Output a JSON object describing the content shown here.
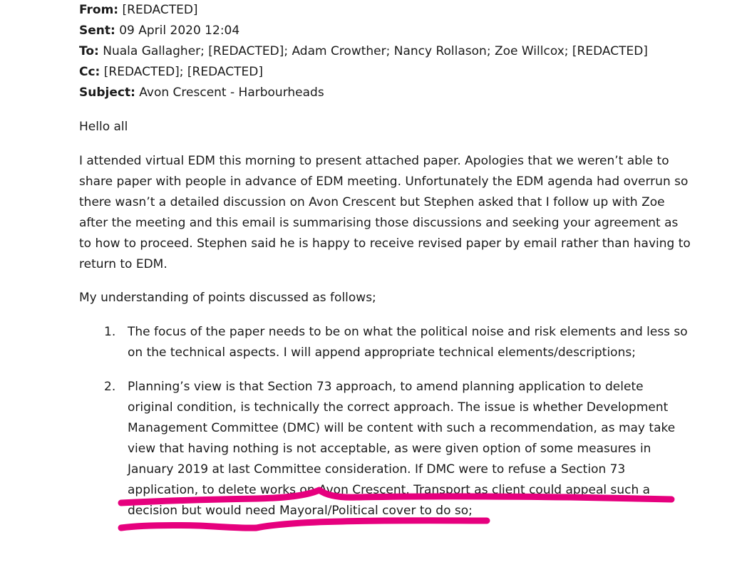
{
  "email_header": {
    "from_label": "From:",
    "from_value": "[REDACTED]",
    "sent_label": "Sent:",
    "sent_value": "09 April 2020 12:04",
    "to_label": "To:",
    "to_value": "Nuala Gallagher; [REDACTED]; Adam Crowther; Nancy Rollason; Zoe Willcox; [REDACTED]",
    "cc_label": "Cc:",
    "cc_value": "[REDACTED]; [REDACTED]",
    "subject_label": "Subject:",
    "subject_value": "Avon Crescent - Harbourheads"
  },
  "body": {
    "greeting": "Hello all",
    "para1": "I attended virtual EDM this morning to present attached paper. Apologies that we weren’t able to share paper with people in advance of EDM meeting. Unfortunately the EDM agenda had overrun so there wasn’t a detailed discussion on Avon Crescent but Stephen asked that I follow up with Zoe after the meeting and this email is summarising those discussions and seeking your agreement as to how to proceed. Stephen said he is happy to receive revised paper by email rather than having to return to EDM.",
    "para2": "My understanding of points discussed as follows;",
    "items": [
      {
        "number": "1.",
        "text": "The focus of the paper needs to be on what the political noise and risk elements and less so on the technical aspects. I will append appropriate technical elements/descriptions;"
      },
      {
        "number": "2.",
        "text": "Planning’s view is that Section 73 approach, to amend planning application to delete original condition, is technically the correct approach. The issue is whether Development Management Committee (DMC) will be content with such a recommendation, as may take view that having nothing is not acceptable, as were given option of some measures in January 2019 at last Committee consideration. If DMC were to refuse a Section 73 application, to delete works on Avon Crescent, Transport as client could appeal such a decision but would need Mayoral/Political cover to do so;"
      }
    ]
  },
  "colors": {
    "highlight_ink": "#e6007e"
  }
}
